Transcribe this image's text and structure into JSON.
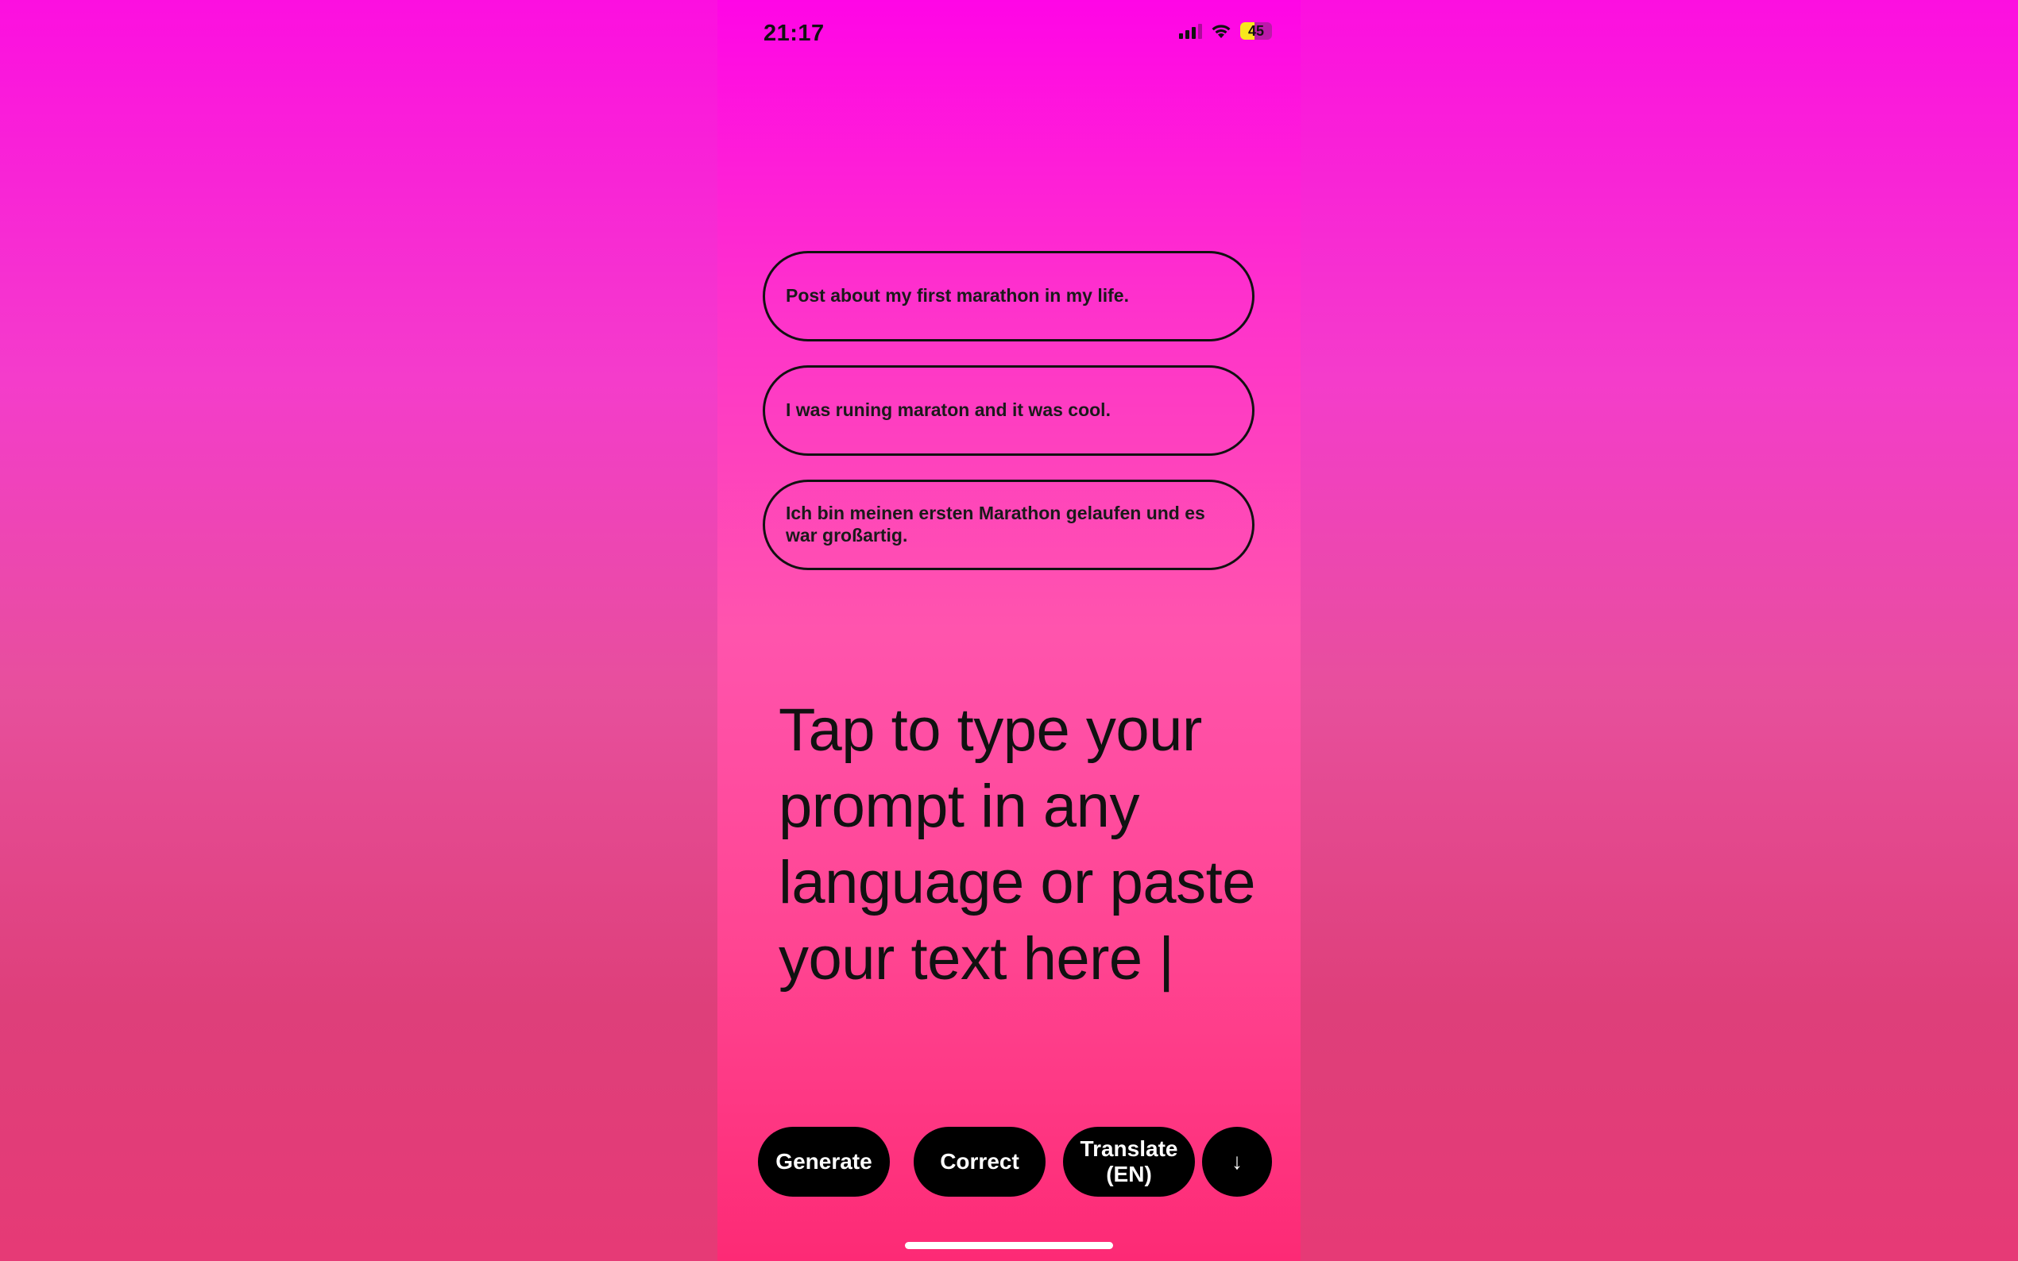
{
  "status_bar": {
    "time": "21:17",
    "battery_level": "45",
    "battery_fraction": 0.45
  },
  "suggestions": [
    "Post about my first marathon in my life.",
    "I was runing maraton and it was cool.",
    "Ich bin meinen ersten Marathon gelaufen und es war großartig."
  ],
  "prompt": {
    "text": "Tap to type your prompt in any language or paste your text here |"
  },
  "toolbar": {
    "generate_label": "Generate",
    "correct_label": "Correct",
    "translate_label": "Translate\n(EN)",
    "down_glyph": "↓"
  }
}
